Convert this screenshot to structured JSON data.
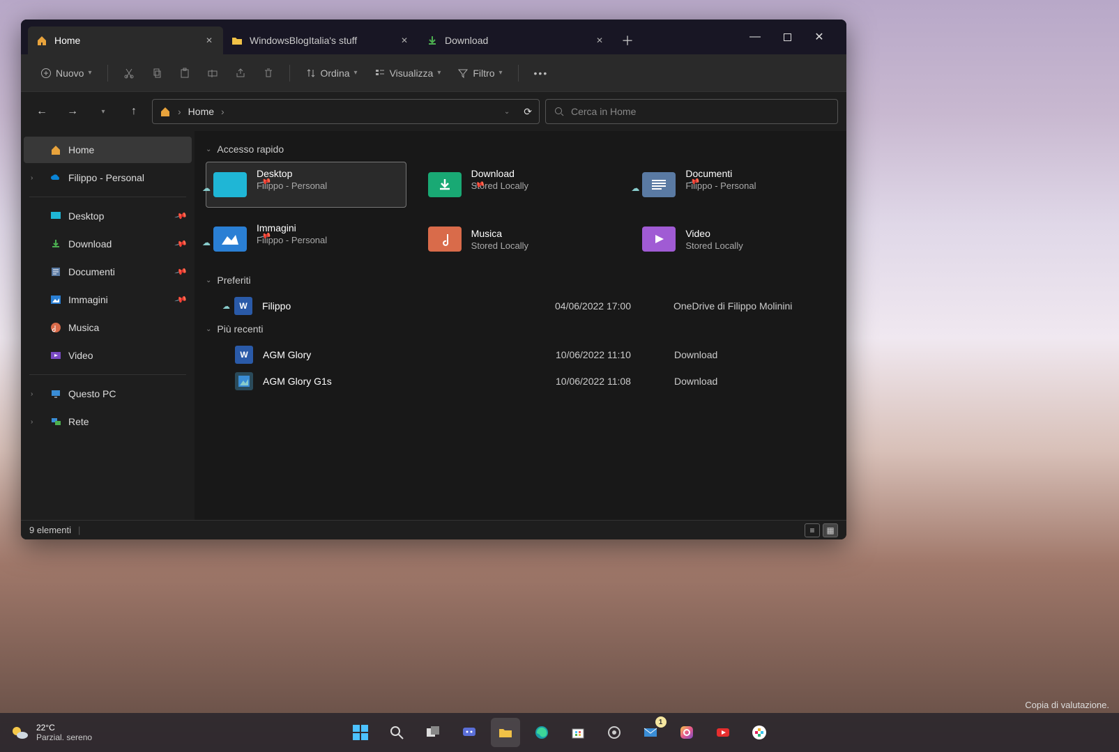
{
  "tabs": [
    {
      "label": "Home",
      "active": true
    },
    {
      "label": "WindowsBlogItalia's stuff",
      "active": false
    },
    {
      "label": "Download",
      "active": false
    }
  ],
  "winbtn": {
    "min": "—",
    "max": "▢",
    "close": "✕"
  },
  "toolbar": {
    "new": "Nuovo",
    "sort": "Ordina",
    "view": "Visualizza",
    "filter": "Filtro"
  },
  "breadcrumb": {
    "current": "Home"
  },
  "search": {
    "placeholder": "Cerca in Home"
  },
  "sidebar": {
    "home": "Home",
    "onedrive": "Filippo - Personal",
    "desktop": "Desktop",
    "download": "Download",
    "documents": "Documenti",
    "images": "Immagini",
    "music": "Musica",
    "video": "Video",
    "thispc": "Questo PC",
    "network": "Rete"
  },
  "groups": {
    "quick": "Accesso rapido",
    "fav": "Preferiti",
    "recent": "Più recenti"
  },
  "quick_items": [
    {
      "title": "Desktop",
      "sub": "Filippo - Personal",
      "pinned": true,
      "cloud": true,
      "selected": true,
      "color": "#1fb6d6"
    },
    {
      "title": "Download",
      "sub": "Stored Locally",
      "pinned": true,
      "cloud": false,
      "selected": false,
      "color": "#19a974"
    },
    {
      "title": "Documenti",
      "sub": "Filippo - Personal",
      "pinned": true,
      "cloud": true,
      "selected": false,
      "color": "#5a7aa3"
    },
    {
      "title": "Immagini",
      "sub": "Filippo - Personal",
      "pinned": true,
      "cloud": true,
      "selected": false,
      "color": "#2a7fd4"
    },
    {
      "title": "Musica",
      "sub": "Stored Locally",
      "pinned": false,
      "cloud": false,
      "selected": false,
      "color": "#d96b4a"
    },
    {
      "title": "Video",
      "sub": "Stored Locally",
      "pinned": false,
      "cloud": false,
      "selected": false,
      "color": "#a05bd4"
    }
  ],
  "favorites": [
    {
      "name": "Filippo",
      "date": "04/06/2022 17:00",
      "loc": "OneDrive di Filippo Molinini",
      "icon": "word",
      "cloud": true
    }
  ],
  "recents": [
    {
      "name": "AGM Glory",
      "date": "10/06/2022 11:10",
      "loc": "Download",
      "icon": "word",
      "cloud": false
    },
    {
      "name": "AGM Glory G1s",
      "date": "10/06/2022 11:08",
      "loc": "Download",
      "icon": "image",
      "cloud": false
    }
  ],
  "status": {
    "count": "9 elementi"
  },
  "watermark": "Copia di valutazione.",
  "taskbar": {
    "temp": "22°C",
    "weather": "Parzial. sereno",
    "badge": "1"
  }
}
